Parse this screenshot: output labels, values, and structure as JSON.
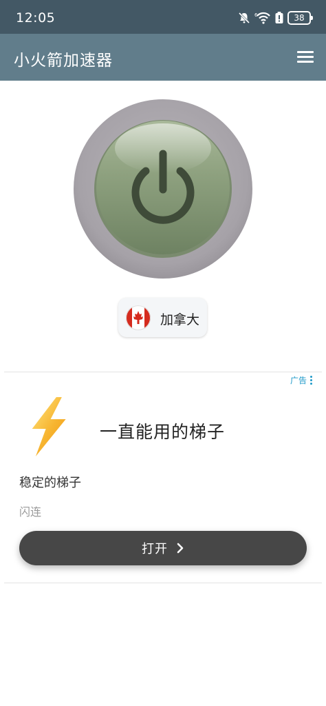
{
  "status_bar": {
    "time": "12:05",
    "battery": "38",
    "icons": [
      "bell-muted-icon",
      "wifi-6-icon",
      "battery-alert-icon",
      "battery-icon"
    ]
  },
  "app_bar": {
    "title": "小火箭加速器",
    "menu_icon": "hamburger-menu-icon",
    "background_color": "#617d8b"
  },
  "power_button": {
    "icon": "power-icon",
    "state": "off"
  },
  "location": {
    "country": "加拿大",
    "flag_icon": "canada-flag-icon"
  },
  "ad": {
    "label": "广告",
    "title": "一直能用的梯子",
    "body": "稳定的梯子",
    "advertiser": "闪连",
    "cta": "打开",
    "logo_icon": "lightning-bolt-icon"
  },
  "colors": {
    "status_bar": "#435865",
    "app_bar": "#617d8b",
    "ad_label": "#1f9ac9",
    "cta_button": "#474747"
  }
}
